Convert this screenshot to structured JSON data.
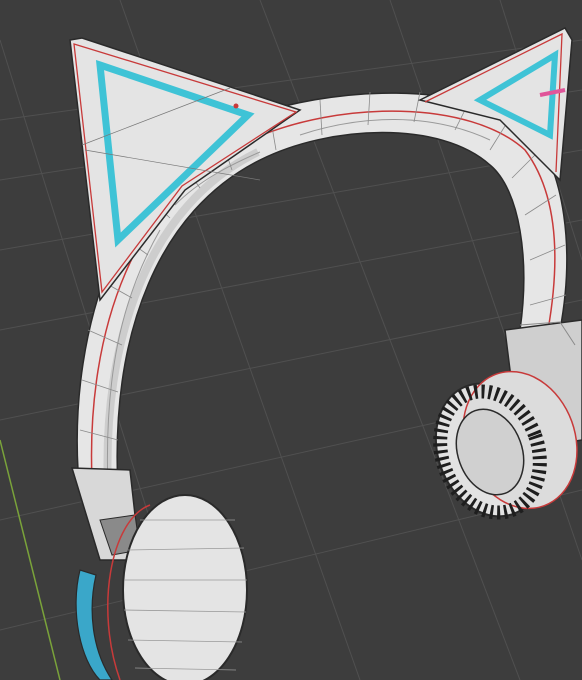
{
  "viewport": {
    "background_color": "#3d3d3d",
    "grid_color": "#505050",
    "axis_y_color": "#7aa33a",
    "model": {
      "name": "cat-ear-headphones",
      "body_color": "#e6e6e6",
      "shade_color": "#bdbdbd",
      "edge_color": "#2a2a2a",
      "seam_color": "#c83a3a",
      "ear_accent_color": "#3fc3d6",
      "mark_color": "#e0559a",
      "cushion_color": "#3aa7c9",
      "driver_grille_color": "#1e1e1e"
    }
  }
}
